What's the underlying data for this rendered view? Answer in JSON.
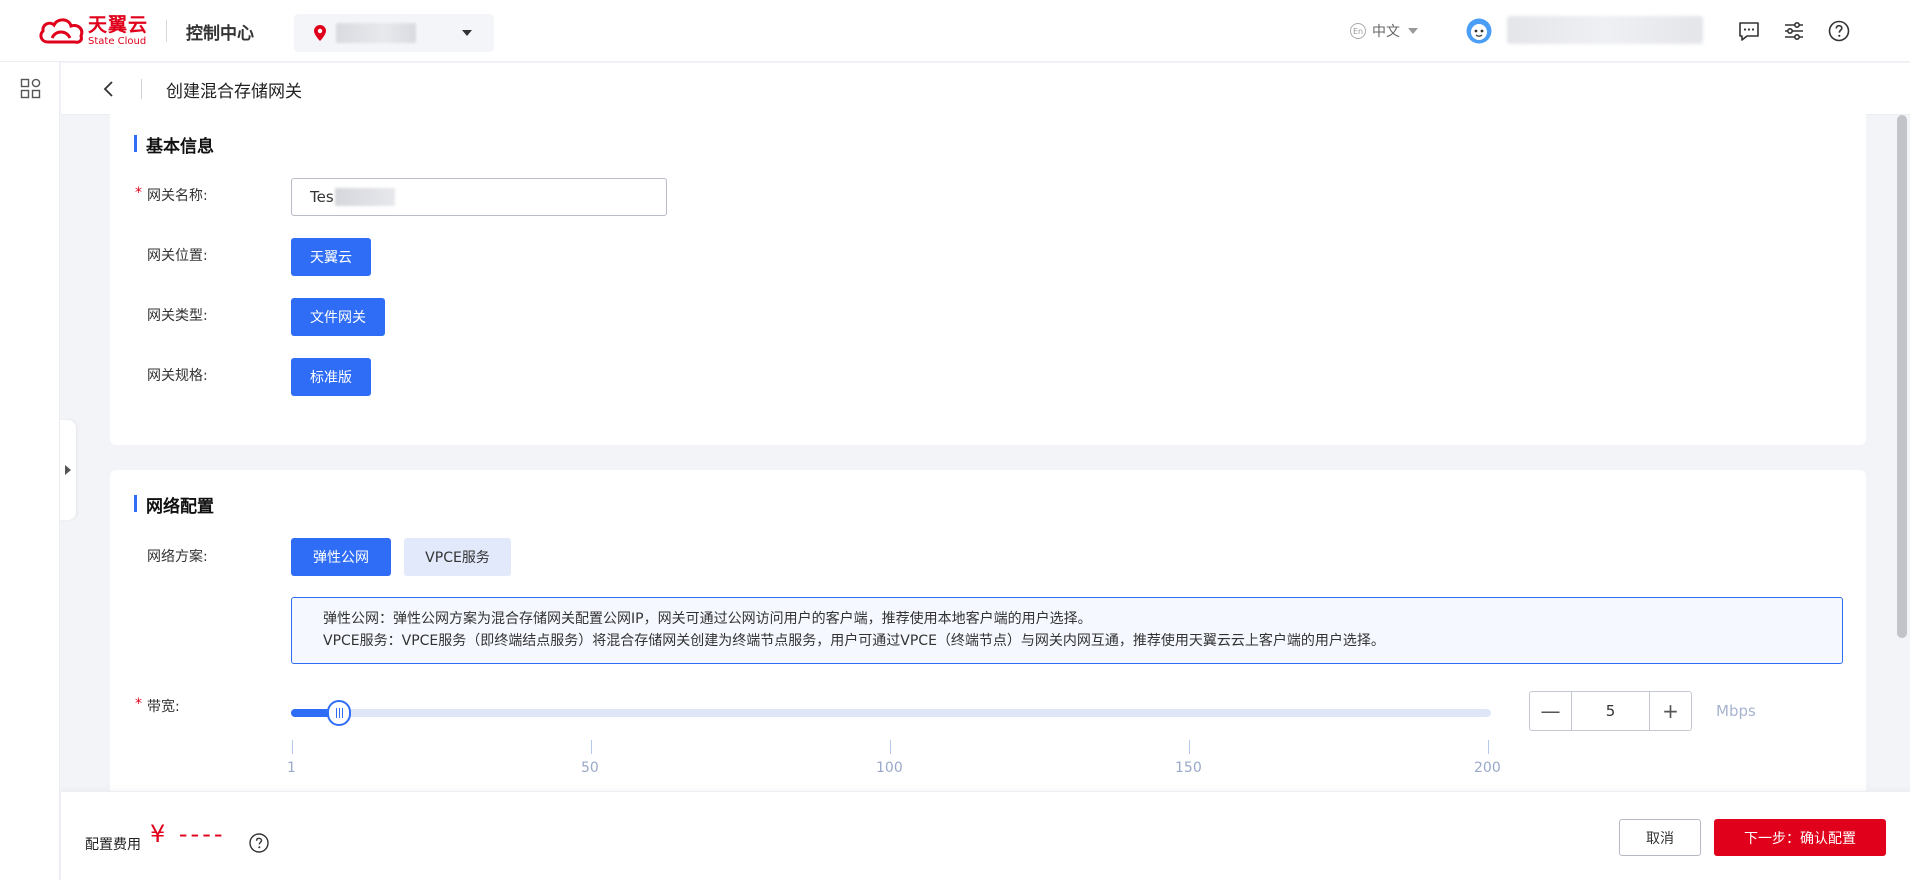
{
  "header": {
    "brand_cn": "天翼云",
    "brand_en": "State Cloud",
    "console_title": "控制中心",
    "language": "中文",
    "lang_icon_text": "En"
  },
  "subheader": {
    "title": "创建混合存储网关"
  },
  "basic_info": {
    "section_title": "基本信息",
    "gateway_name_label": "网关名称:",
    "gateway_name_value": "Tes",
    "location_label": "网关位置:",
    "location_value": "天翼云",
    "type_label": "网关类型:",
    "type_value": "文件网关",
    "spec_label": "网关规格:",
    "spec_value": "标准版"
  },
  "network": {
    "section_title": "网络配置",
    "scheme_label": "网络方案:",
    "options": [
      "弹性公网",
      "VPCE服务"
    ],
    "selected_option": "弹性公网",
    "info_line1": "弹性公网：弹性公网方案为混合存储网关配置公网IP，网关可通过公网访问用户的客户端，推荐使用本地客户端的用户选择。",
    "info_line2": "VPCE服务：VPCE服务（即终端结点服务）将混合存储网关创建为终端节点服务，用户可通过VPCE（终端节点）与网关内网互通，推荐使用天翼云云上客户端的用户选择。",
    "bandwidth_label": "带宽:",
    "bandwidth_value": "5",
    "bandwidth_min": 1,
    "bandwidth_max": 200,
    "bandwidth_ticks": [
      "1",
      "50",
      "100",
      "150",
      "200"
    ],
    "unit": "Mbps",
    "minus_label": "—",
    "plus_label": "+"
  },
  "footer": {
    "fee_label": "配置费用",
    "fee_value": "¥ ----",
    "cancel_label": "取消",
    "next_label": "下一步：确认配置"
  },
  "colors": {
    "brand_red": "#e0001b",
    "primary_blue": "#2f6df6"
  }
}
